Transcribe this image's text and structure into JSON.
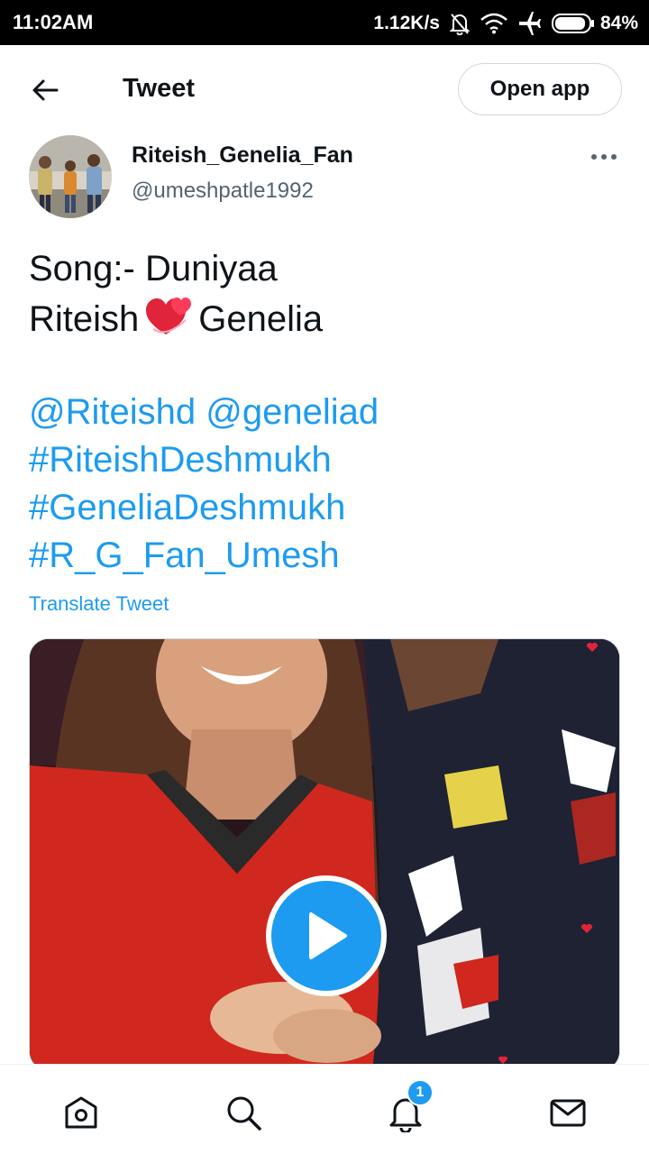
{
  "status_bar": {
    "time": "11:02AM",
    "speed": "1.12K/s",
    "battery": "84%",
    "icons": [
      "bell-off-icon",
      "wifi-icon",
      "airplane-icon",
      "battery-icon"
    ]
  },
  "header": {
    "title": "Tweet",
    "open_app_label": "Open app",
    "back_icon": "arrow-left-icon"
  },
  "author": {
    "display_name": "Riteish_Genelia_Fan",
    "handle": "@umeshpatle1992"
  },
  "tweet": {
    "line1": "Song:- Duniyaa",
    "line2_a": "Riteish",
    "emoji": "💞",
    "line2_b": "Genelia",
    "mention1": "@Riteishd",
    "mention2": "@geneliad",
    "hashtag1": "#RiteishDeshmukh",
    "hashtag2": "#GeneliaDeshmukh",
    "hashtag3": "#R_G_Fan_Umesh",
    "translate_label": "Translate Tweet"
  },
  "media": {
    "type": "video",
    "play_icon": "play-icon"
  },
  "bottom_nav": {
    "items": [
      "home-icon",
      "search-icon",
      "notifications-icon",
      "messages-icon"
    ],
    "notification_count": "1"
  },
  "colors": {
    "accent": "#1d9bf0",
    "text": "#0f1419",
    "secondary": "#536471",
    "status_bar": "#000000"
  }
}
